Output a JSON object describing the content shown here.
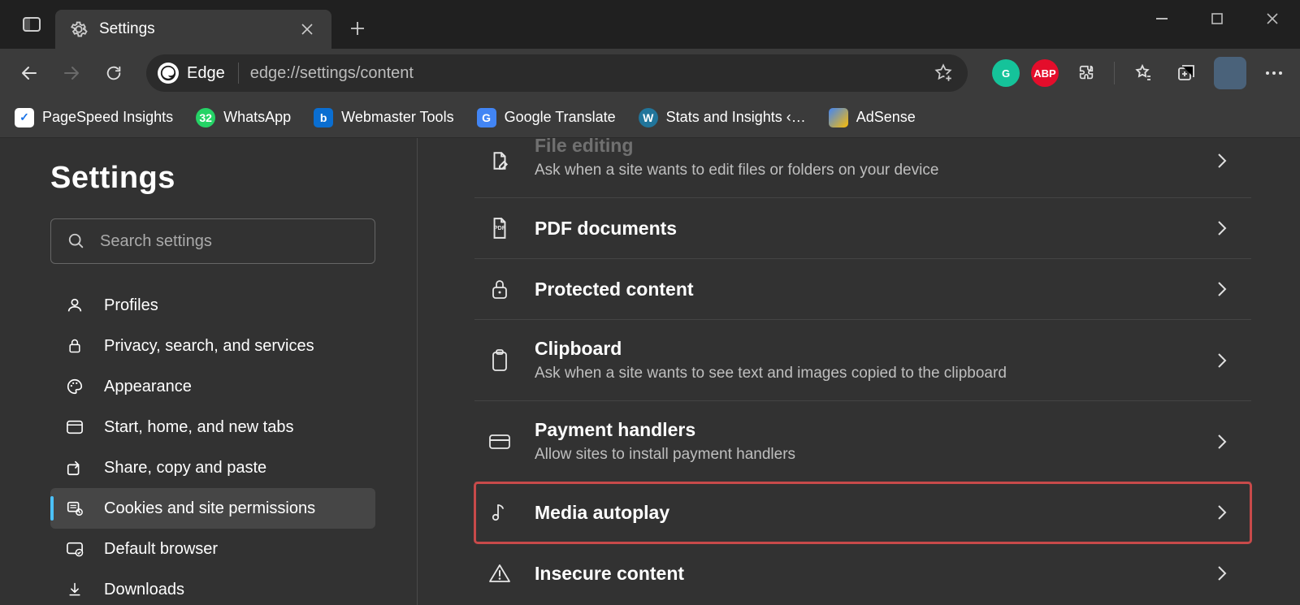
{
  "titlebar": {
    "tab_title": "Settings"
  },
  "toolbar": {
    "edge_label": "Edge",
    "url": "edge://settings/content"
  },
  "bookmarks": [
    {
      "label": "PageSpeed Insights",
      "color": "#fff"
    },
    {
      "label": "WhatsApp",
      "color": "#25d366"
    },
    {
      "label": "Webmaster Tools",
      "color": "#0a6ed1"
    },
    {
      "label": "Google Translate",
      "color": "#4285f4"
    },
    {
      "label": "Stats and Insights ‹…",
      "color": "#21759b"
    },
    {
      "label": "AdSense",
      "color": "#fbbc05"
    }
  ],
  "sidebar": {
    "heading": "Settings",
    "search_placeholder": "Search settings",
    "items": [
      {
        "label": "Profiles"
      },
      {
        "label": "Privacy, search, and services"
      },
      {
        "label": "Appearance"
      },
      {
        "label": "Start, home, and new tabs"
      },
      {
        "label": "Share, copy and paste"
      },
      {
        "label": "Cookies and site permissions"
      },
      {
        "label": "Default browser"
      },
      {
        "label": "Downloads"
      }
    ]
  },
  "permissions": [
    {
      "title": "File editing",
      "sub": "Ask when a site wants to edit files or folders on your device"
    },
    {
      "title": "PDF documents",
      "sub": ""
    },
    {
      "title": "Protected content",
      "sub": ""
    },
    {
      "title": "Clipboard",
      "sub": "Ask when a site wants to see text and images copied to the clipboard"
    },
    {
      "title": "Payment handlers",
      "sub": "Allow sites to install payment handlers"
    },
    {
      "title": "Media autoplay",
      "sub": ""
    },
    {
      "title": "Insecure content",
      "sub": ""
    }
  ]
}
